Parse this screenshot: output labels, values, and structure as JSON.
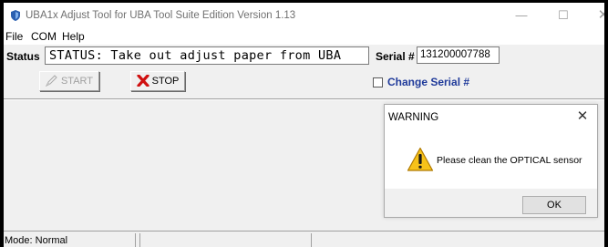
{
  "window": {
    "title": "UBA1x Adjust Tool for UBA Tool Suite Edition Version 1.13",
    "icon": "app-shield-icon",
    "controls": {
      "minimize": "—",
      "maximize": "☐",
      "close": "✕"
    }
  },
  "menu": {
    "items": [
      "File",
      "COM",
      "Help"
    ]
  },
  "status": {
    "label": "Status",
    "value": "STATUS: Take out adjust paper from UBA"
  },
  "serial": {
    "label": "Serial #",
    "value": "131200007788"
  },
  "buttons": {
    "start_label": "START",
    "start_icon": "pencil-check-icon",
    "stop_label": "STOP",
    "stop_icon": "red-x-icon"
  },
  "change_serial": {
    "label": "Change Serial #",
    "checked": false
  },
  "statusbar": {
    "mode": "Mode: Normal"
  },
  "dialog": {
    "title": "WARNING",
    "close": "✕",
    "icon": "warning-icon",
    "message": "Please clean the OPTICAL sensor",
    "ok_label": "OK"
  },
  "colors": {
    "accent_link": "#1f3a9a",
    "stop_icon": "#d01010",
    "warning_yellow": "#f7c21a"
  }
}
